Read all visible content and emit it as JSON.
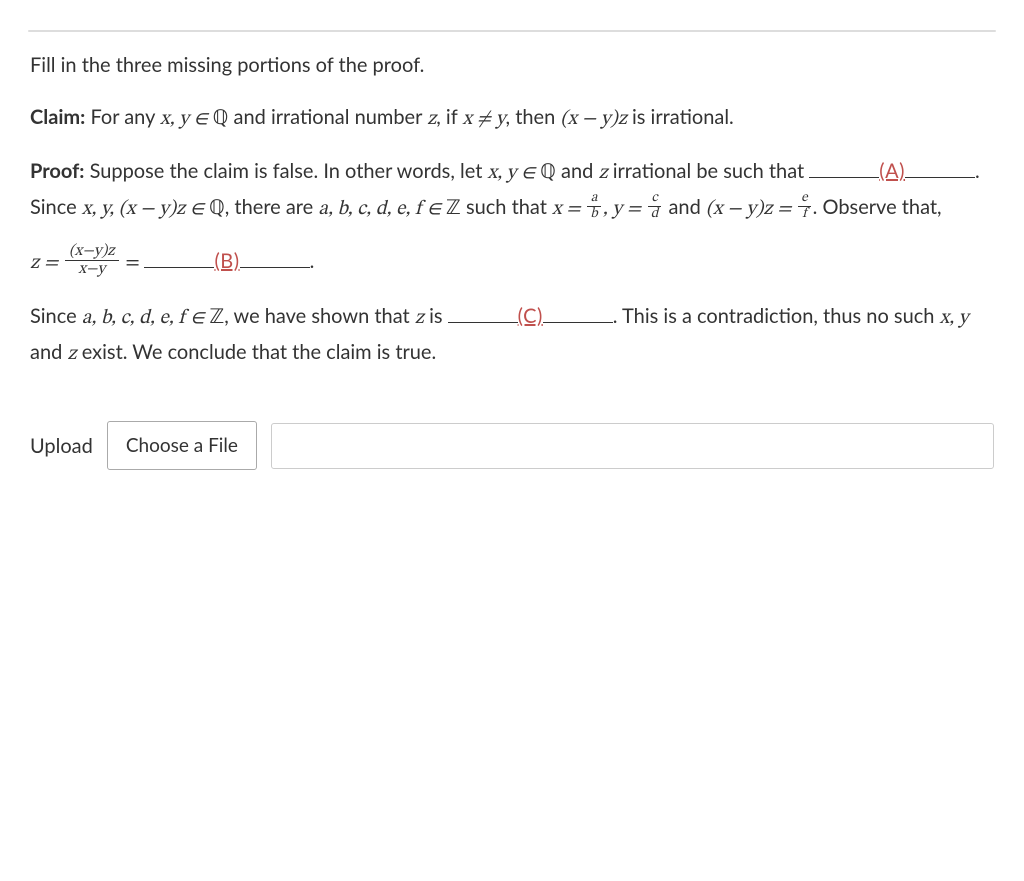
{
  "instruction": "Fill in the three missing portions of the proof.",
  "claim_label": "Claim:",
  "claim_part1": "For any ",
  "claim_math1": "x, y ∈ ",
  "claim_part2": " and irrational number ",
  "claim_math_z": "z",
  "claim_part3": ", if ",
  "claim_math2": "x ≠ y",
  "claim_part4": ", then ",
  "claim_math3": "(x − y)z",
  "claim_part5": " is irrational.",
  "proof_label": "Proof:",
  "proof_p1_a": "Suppose the claim is false.  In other words, let ",
  "proof_p1_math1": "x, y ∈ ",
  "proof_p1_b": " and ",
  "proof_p1_math_z": "z",
  "proof_p1_c": " irrational be such that ",
  "blank_a": "(A)",
  "proof_p1_d": ".  Since ",
  "proof_p1_math2": "x, y, (x − y)z ∈ ",
  "proof_p1_e": ", there are ",
  "proof_p1_math3": "a, b, c, d, e, f ∈ ",
  "proof_p1_f": " such that ",
  "eq_x": "x = ",
  "frac_ab_num": "a",
  "frac_ab_den": "b",
  "eq_y": ", y = ",
  "frac_cd_num": "c",
  "frac_cd_den": "d",
  "eq_and": " and ",
  "eq_xyz": "(x − y)z = ",
  "frac_ef_num": "e",
  "frac_ef_den": "f",
  "proof_p1_g": ". Observe that,",
  "eq_z": "z = ",
  "frac_big_num": "(x−y)z",
  "frac_big_den": "x−y",
  "eq_equals": " = ",
  "blank_b": "(B)",
  "proof_p2_a": "Since ",
  "proof_p2_math1": "a, b, c, d, e, f ∈ ",
  "proof_p2_b": ", we have shown that ",
  "proof_p2_math_z": "z",
  "proof_p2_c": " is ",
  "blank_c": "(C)",
  "proof_p2_d": ".  This is a contradiction, thus no such ",
  "proof_p2_math2": "x, y",
  "proof_p2_e": " and ",
  "proof_p2_math3": "z",
  "proof_p2_f": " exist.  We conclude that the claim is true.",
  "symbols": {
    "Q": "ℚ",
    "Z": "ℤ"
  },
  "upload": {
    "label": "Upload",
    "button": "Choose a File"
  }
}
